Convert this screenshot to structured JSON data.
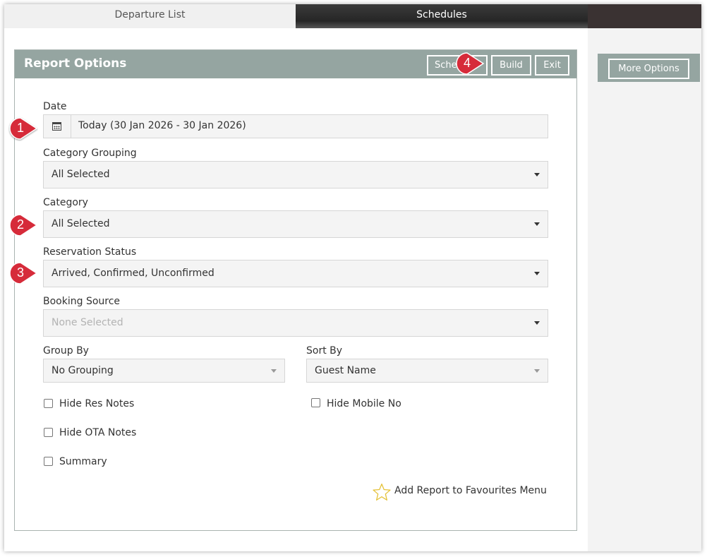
{
  "tabs": {
    "departure_list": "Departure List",
    "schedules": "Schedules"
  },
  "panel": {
    "title": "Report Options",
    "buttons": {
      "schedule": "Schedule",
      "build": "Build",
      "exit": "Exit"
    }
  },
  "sidebar": {
    "more_options": "More Options"
  },
  "form": {
    "date": {
      "label": "Date",
      "value": "Today (30 Jan 2026 - 30 Jan 2026)",
      "icon": "calendar-icon"
    },
    "category_grouping": {
      "label": "Category Grouping",
      "value": "All Selected"
    },
    "category": {
      "label": "Category",
      "value": "All Selected"
    },
    "reservation_status": {
      "label": "Reservation Status",
      "value": "Arrived, Confirmed, Unconfirmed"
    },
    "booking_source": {
      "label": "Booking Source",
      "placeholder": "None Selected"
    },
    "group_by": {
      "label": "Group By",
      "value": "No Grouping"
    },
    "sort_by": {
      "label": "Sort By",
      "value": "Guest Name"
    },
    "checkboxes": {
      "hide_res_notes": {
        "label": "Hide Res Notes",
        "checked": false
      },
      "hide_mobile_no": {
        "label": "Hide Mobile No",
        "checked": false
      },
      "hide_ota_notes": {
        "label": "Hide OTA Notes",
        "checked": false
      },
      "summary": {
        "label": "Summary",
        "checked": false
      }
    },
    "favourites": {
      "label": "Add Report to Favourites Menu",
      "icon": "star-icon"
    }
  },
  "markers": [
    "1",
    "2",
    "3",
    "4"
  ],
  "colors": {
    "panel_header": "#95a5a1",
    "marker_red": "#d62b3a",
    "tab_dark": "#2e2e2e",
    "star": "#e5c23a"
  }
}
